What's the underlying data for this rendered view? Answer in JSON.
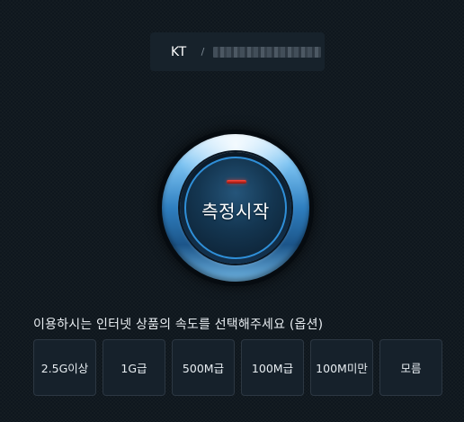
{
  "connection": {
    "isp": "KT",
    "separator": "/"
  },
  "start_button": {
    "label": "측정시작"
  },
  "speed_selection": {
    "prompt": "이용하시는 인터넷 상품의 속도를 선택해주세요 (옵션)",
    "options": [
      "2.5G이상",
      "1G급",
      "500M급",
      "100M급",
      "100M미만",
      "모름"
    ]
  },
  "colors": {
    "background": "#0f171e",
    "button_accent": "#2f8fd8",
    "indicator": "#ff4a3e"
  }
}
